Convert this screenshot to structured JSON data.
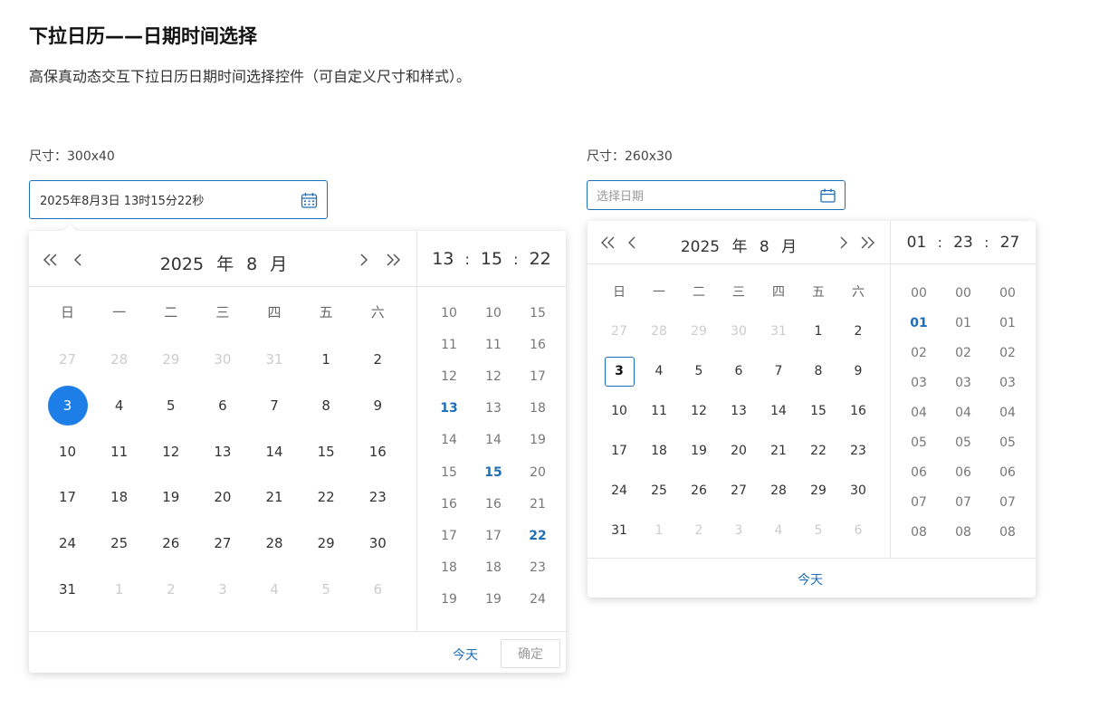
{
  "page": {
    "title": "下拉日历——日期时间选择",
    "description": "高保真动态交互下拉日历日期时间选择控件（可自定义尺寸和样式）。"
  },
  "picker1": {
    "size_label": "尺寸：300x40",
    "value": "2025年8月3日 13时15分22秒",
    "header": {
      "year": "2025",
      "year_unit": "年",
      "month": "8",
      "month_unit": "月"
    },
    "weekdays": [
      "日",
      "一",
      "二",
      "三",
      "四",
      "五",
      "六"
    ],
    "days": [
      [
        "27",
        "28",
        "29",
        "30",
        "31",
        "1",
        "2"
      ],
      [
        "3",
        "4",
        "5",
        "6",
        "7",
        "8",
        "9"
      ],
      [
        "10",
        "11",
        "12",
        "13",
        "14",
        "15",
        "16"
      ],
      [
        "17",
        "18",
        "19",
        "20",
        "21",
        "22",
        "23"
      ],
      [
        "24",
        "25",
        "26",
        "27",
        "28",
        "29",
        "30"
      ],
      [
        "31",
        "1",
        "2",
        "3",
        "4",
        "5",
        "6"
      ]
    ],
    "time": {
      "hour": "13",
      "minute": "15",
      "second": "22",
      "sep": ":"
    },
    "hours": [
      "10",
      "11",
      "12",
      "13",
      "14",
      "15",
      "16",
      "17",
      "18",
      "19"
    ],
    "minutes": [
      "10",
      "11",
      "12",
      "13",
      "14",
      "15",
      "16",
      "17",
      "18",
      "19"
    ],
    "seconds": [
      "15",
      "16",
      "17",
      "18",
      "19",
      "20",
      "21",
      "22",
      "23",
      "24"
    ],
    "today_label": "今天",
    "ok_label": "确定"
  },
  "picker2": {
    "size_label": "尺寸：260x30",
    "placeholder": "选择日期",
    "header": {
      "year": "2025",
      "year_unit": "年",
      "month": "8",
      "month_unit": "月"
    },
    "weekdays": [
      "日",
      "一",
      "二",
      "三",
      "四",
      "五",
      "六"
    ],
    "days": [
      [
        "27",
        "28",
        "29",
        "30",
        "31",
        "1",
        "2"
      ],
      [
        "3",
        "4",
        "5",
        "6",
        "7",
        "8",
        "9"
      ],
      [
        "10",
        "11",
        "12",
        "13",
        "14",
        "15",
        "16"
      ],
      [
        "17",
        "18",
        "19",
        "20",
        "21",
        "22",
        "23"
      ],
      [
        "24",
        "25",
        "26",
        "27",
        "28",
        "29",
        "30"
      ],
      [
        "31",
        "1",
        "2",
        "3",
        "4",
        "5",
        "6"
      ]
    ],
    "time": {
      "hour": "01",
      "minute": "23",
      "second": "27",
      "sep": ":"
    },
    "hours": [
      "00",
      "01",
      "02",
      "03",
      "04",
      "05",
      "06",
      "07",
      "08"
    ],
    "minutes": [
      "00",
      "01",
      "02",
      "03",
      "04",
      "05",
      "06",
      "07",
      "08"
    ],
    "seconds": [
      "00",
      "01",
      "02",
      "03",
      "04",
      "05",
      "06",
      "07",
      "08"
    ],
    "today_label": "今天"
  },
  "colors": {
    "accent": "#1e6fb8",
    "selected_fill": "#1e7ee8"
  },
  "icons": {
    "calendar": "calendar-icon",
    "prev_year": "double-chevron-left-icon",
    "prev_month": "chevron-left-icon",
    "next_month": "chevron-right-icon",
    "next_year": "double-chevron-right-icon"
  }
}
